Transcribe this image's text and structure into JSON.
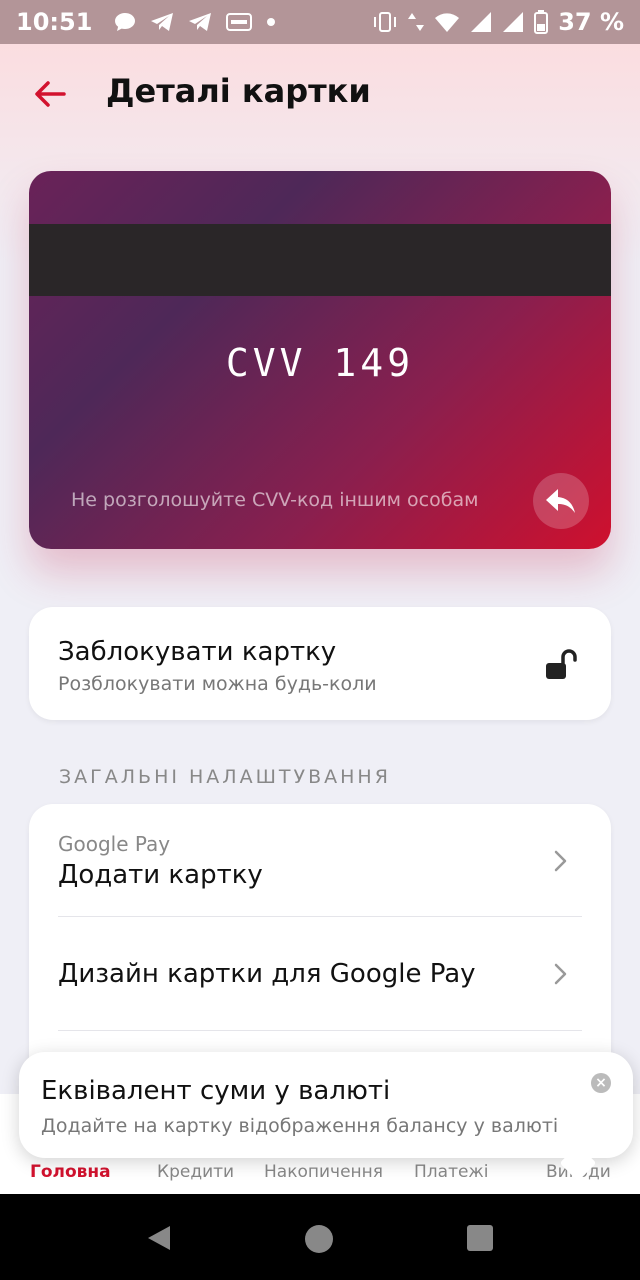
{
  "status_bar": {
    "time": "10:51",
    "battery": "37 %",
    "icons": [
      "chat-icon",
      "telegram-icon",
      "telegram-icon",
      "temu-icon",
      "dot-icon",
      "vibrate-icon",
      "data-icon",
      "wifi-icon",
      "signal-icon",
      "signal-icon",
      "battery-icon"
    ]
  },
  "header": {
    "title": "Деталі картки"
  },
  "card": {
    "cvv": "CVV 149",
    "note": "Не розголошуйте CVV-код іншим особам"
  },
  "block": {
    "title": "Заблокувати картку",
    "subtitle": "Розблокувати можна будь-коли"
  },
  "section": {
    "label": "ЗАГАЛЬНІ НАЛАШТУВАННЯ"
  },
  "settings": {
    "items": [
      {
        "subtitle": "Google Pay",
        "title": "Додати картку"
      },
      {
        "title": "Дизайн картки для Google Pay"
      }
    ]
  },
  "bottom_nav": {
    "items": [
      {
        "label": "Головна"
      },
      {
        "label": "Кредити"
      },
      {
        "label": "Накопичення"
      },
      {
        "label": "Платежі"
      },
      {
        "label": "Вигоди"
      }
    ]
  },
  "toast": {
    "title": "Еквівалент суми у валюті",
    "subtitle": "Додайте на картку відображення балансу у валюті"
  },
  "colors": {
    "accent": "#d2122e",
    "card_start": "#4e2858",
    "card_end": "#cf102e"
  }
}
